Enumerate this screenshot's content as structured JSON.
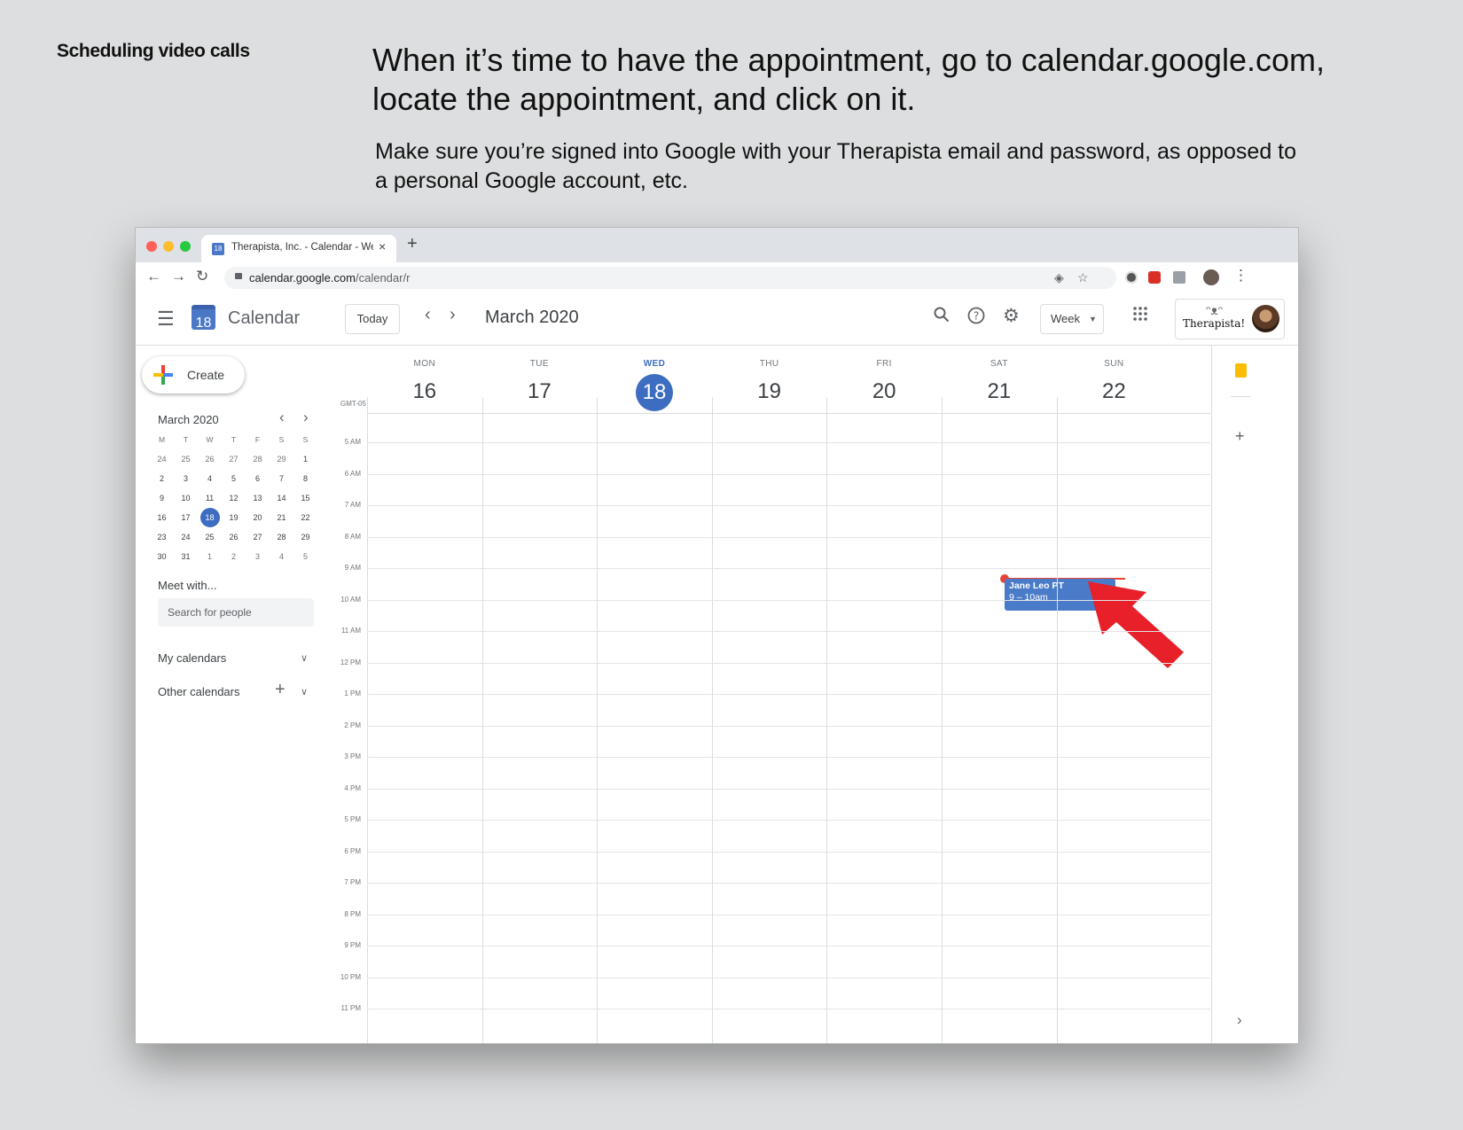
{
  "slide": {
    "section_label": "Scheduling video calls",
    "headline": "When it’s time to have the appointment, go to calendar.google.com, locate the appointment, and click on it.",
    "subtext": "Make sure you’re signed into Google with your Therapista email and password, as opposed to a personal Google account, etc."
  },
  "browser": {
    "tab_title": "Therapista, Inc. - Calendar - Wee",
    "tab_favicon_text": "18",
    "tab_close": "×",
    "new_tab": "+",
    "url_host": "calendar.google.com",
    "url_path": "/calendar/r"
  },
  "calendar": {
    "app_name": "Calendar",
    "logo_day": "18",
    "today_label": "Today",
    "date_range": "March 2020",
    "view_label": "Week",
    "brand_text": "Therapista!",
    "create_label": "Create",
    "mini_title": "March 2020",
    "weekday_initials": [
      "M",
      "T",
      "W",
      "T",
      "F",
      "S",
      "S"
    ],
    "mini_days": [
      [
        "24",
        "25",
        "26",
        "27",
        "28",
        "29",
        "1"
      ],
      [
        "2",
        "3",
        "4",
        "5",
        "6",
        "7",
        "8"
      ],
      [
        "9",
        "10",
        "11",
        "12",
        "13",
        "14",
        "15"
      ],
      [
        "16",
        "17",
        "18",
        "19",
        "20",
        "21",
        "22"
      ],
      [
        "23",
        "24",
        "25",
        "26",
        "27",
        "28",
        "29"
      ],
      [
        "30",
        "31",
        "1",
        "2",
        "3",
        "4",
        "5"
      ]
    ],
    "selected_day": "18",
    "meet_title": "Meet with...",
    "people_placeholder": "Search for people",
    "my_calendars": "My calendars",
    "other_calendars": "Other calendars",
    "timezone": "GMT-05",
    "days": [
      {
        "name": "MON",
        "num": "16"
      },
      {
        "name": "TUE",
        "num": "17"
      },
      {
        "name": "WED",
        "num": "18",
        "today": true
      },
      {
        "name": "THU",
        "num": "19"
      },
      {
        "name": "FRI",
        "num": "20"
      },
      {
        "name": "SAT",
        "num": "21"
      },
      {
        "name": "SUN",
        "num": "22"
      }
    ],
    "hours": [
      "5 AM",
      "6 AM",
      "7 AM",
      "8 AM",
      "9 AM",
      "10 AM",
      "11 AM",
      "12 PM",
      "1 PM",
      "2 PM",
      "3 PM",
      "4 PM",
      "5 PM",
      "6 PM",
      "7 PM",
      "8 PM",
      "9 PM",
      "10 PM",
      "11 PM"
    ],
    "event": {
      "title": "Jane Leo PT",
      "time": "9 – 10am"
    }
  },
  "colors": {
    "accent": "#3d6dc0",
    "event": "#4a7bc8",
    "now_line": "#ea4335",
    "arrow": "#e8202a"
  },
  "icons": [
    "hamburger-icon",
    "search-icon",
    "help-icon",
    "settings-icon",
    "apps-grid-icon",
    "keep-icon",
    "add-icon"
  ]
}
